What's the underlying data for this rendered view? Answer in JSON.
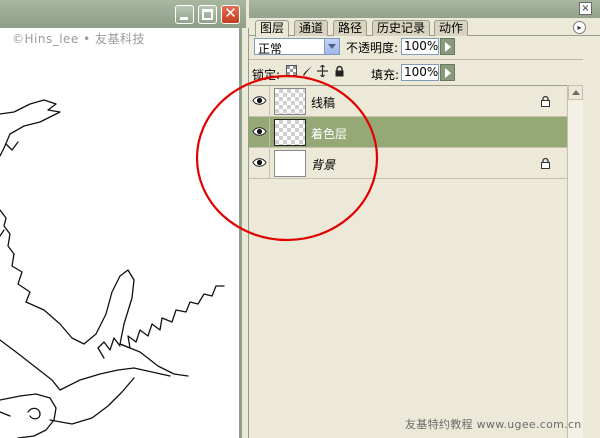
{
  "canvas": {
    "watermark": "©Hins_lee • 友基科技"
  },
  "window_controls": {
    "minimize": "minimize-icon",
    "maximize": "maximize-icon",
    "close_glyph": "✕"
  },
  "panel": {
    "close_glyph": "×",
    "tabs": [
      "图层",
      "通道",
      "路径",
      "历史记录",
      "动作"
    ],
    "menu_glyph": "▸",
    "blend_mode": "正常",
    "opacity_label": "不透明度:",
    "opacity_value": "100%",
    "lock_label": "锁定:",
    "fill_label": "填充:",
    "fill_value": "100%"
  },
  "layers": [
    {
      "name": "线稿",
      "thumbnail": "transparent",
      "selected": false,
      "locked": true,
      "visible": true
    },
    {
      "name": "着色层",
      "thumbnail": "transparent",
      "selected": true,
      "locked": false,
      "visible": true
    },
    {
      "name": "背景",
      "thumbnail": "white",
      "selected": false,
      "locked": true,
      "visible": true
    }
  ],
  "colors": {
    "accent_selected": "#96a876",
    "annotation_circle": "#e00000"
  },
  "footer": {
    "watermark": "友基特约教程 www.ugee.com.cn"
  }
}
